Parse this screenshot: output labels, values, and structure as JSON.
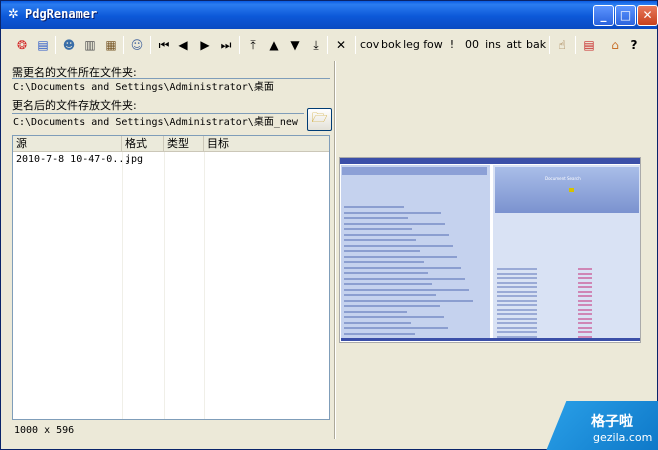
{
  "window": {
    "title": "PdgRenamer",
    "app_icon": "gear-app-icon",
    "controls": {
      "minimize": "_",
      "maximize": "□",
      "close": "✕"
    }
  },
  "toolbar": {
    "icon_buttons": [
      {
        "name": "color-wheel-icon",
        "glyph": "❂",
        "color": "#d32a2a"
      },
      {
        "name": "window-palette-icon",
        "glyph": "▤",
        "color": "#2a58c8"
      },
      {
        "name": "user-settings-icon",
        "glyph": "☻",
        "color": "#3a6ea8"
      },
      {
        "name": "column-list-icon",
        "glyph": "▥",
        "color": "#555555"
      },
      {
        "name": "book-icon",
        "glyph": "▦",
        "color": "#7a5a2a"
      },
      {
        "name": "users-group-icon",
        "glyph": "☺",
        "color": "#4a6aa0"
      },
      {
        "name": "first-icon",
        "glyph": "⏮",
        "color": "#000000"
      },
      {
        "name": "previous-icon",
        "glyph": "◀",
        "color": "#000000"
      },
      {
        "name": "next-icon",
        "glyph": "▶",
        "color": "#000000"
      },
      {
        "name": "last-icon",
        "glyph": "⏭",
        "color": "#000000"
      },
      {
        "name": "move-top-icon",
        "glyph": "⤒",
        "color": "#000000"
      },
      {
        "name": "move-up-icon",
        "glyph": "▲",
        "color": "#000000"
      },
      {
        "name": "move-down-icon",
        "glyph": "▼",
        "color": "#000000"
      },
      {
        "name": "move-bottom-icon",
        "glyph": "⤓",
        "color": "#000000"
      },
      {
        "name": "delete-icon",
        "glyph": "✕",
        "color": "#000000"
      }
    ],
    "text_buttons": [
      "cov",
      "bok",
      "leg",
      "fow",
      "!",
      "00",
      "ins",
      "att",
      "bak"
    ],
    "right_icons": [
      {
        "name": "hand-pointer-icon",
        "glyph": "☝",
        "color": "#8a5a20"
      },
      {
        "name": "window-refresh-icon",
        "glyph": "▤",
        "color": "#c82a2a"
      },
      {
        "name": "home-icon",
        "glyph": "⌂",
        "color": "#c8702a"
      },
      {
        "name": "help-icon",
        "glyph": "?",
        "color": "#000000"
      }
    ]
  },
  "source": {
    "label": "需更名的文件所在文件夹:",
    "path": "C:\\Documents and Settings\\Administrator\\桌面"
  },
  "target": {
    "label": "更名后的文件存放文件夹:",
    "path": "C:\\Documents and Settings\\Administrator\\桌面_new"
  },
  "browse_icon": "folder-open-icon",
  "file_list": {
    "columns": [
      "源",
      "格式",
      "类型",
      "目标"
    ],
    "rows": [
      {
        "source": "2010-7-8 10-47-0...",
        "format": "jpg",
        "type": "",
        "target": ""
      }
    ]
  },
  "status": {
    "dimensions": "1000 x 596"
  },
  "preview": {
    "banner_text": "Document Search"
  },
  "watermark": {
    "main": "格子啦",
    "sub": "gezila.com"
  }
}
